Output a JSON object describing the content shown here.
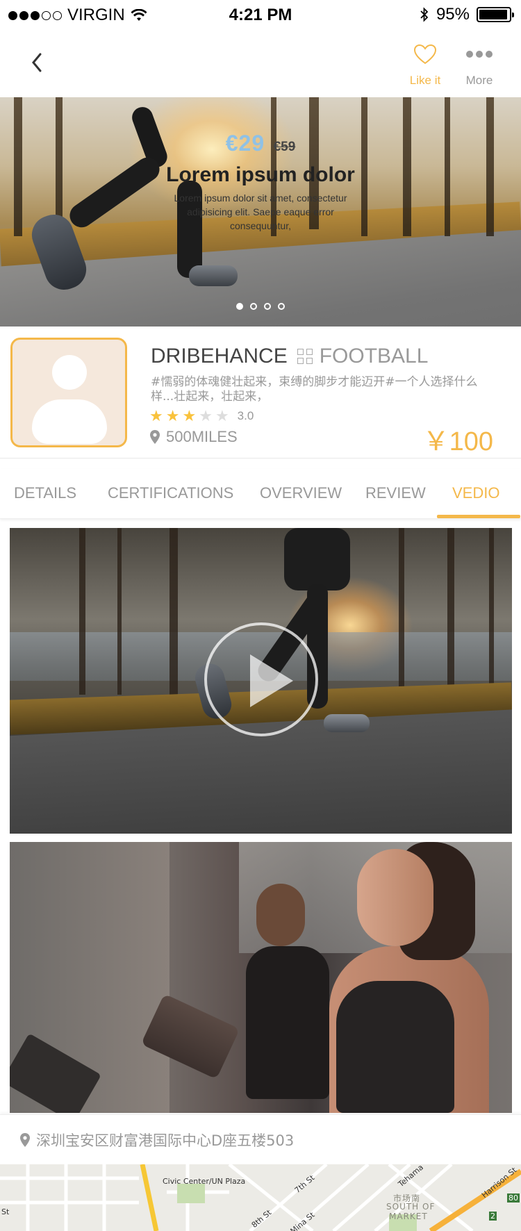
{
  "status_bar": {
    "carrier": "VIRGIN",
    "time": "4:21 PM",
    "battery": "95%",
    "signal_strength": 3
  },
  "nav": {
    "like_label": "Like it",
    "more_label": "More"
  },
  "hero": {
    "price_now": "€29",
    "price_old": "€59",
    "title": "Lorem ipsum dolor",
    "description": "Lorem ipsum dolor sit amet, consectetur adipisicing elit. Saepe eaque error consequuntur,",
    "slide_count": 4,
    "active_slide": 1
  },
  "profile": {
    "name": "DRIBEHANCE",
    "category": "FOOTBALL",
    "description": "#懦弱的体魂健壮起来，束缚的脚步才能迈开#一个人选择什么样...壮起来，壮起来，",
    "rating": 3,
    "rating_max": 5,
    "rating_text": "3.0",
    "distance": "500MILES",
    "price": "￥100"
  },
  "tabs": [
    {
      "label": "DETAILS",
      "active": false
    },
    {
      "label": "CERTIFICATIONS",
      "active": false
    },
    {
      "label": "OVERVIEW",
      "active": false
    },
    {
      "label": "REVIEW",
      "active": false
    },
    {
      "label": "VEDIO",
      "active": true
    }
  ],
  "address": {
    "text": "深圳宝安区财富港国际中心D座五楼503"
  },
  "map": {
    "labels": [
      "Civic Center/UN Plaza",
      "7th St",
      "8th St",
      "Mina St",
      "Tehama",
      "市场南",
      "SOUTH OF",
      "MARKET",
      "Harrison St",
      "80",
      "St",
      "2"
    ]
  },
  "colors": {
    "accent": "#f4b84a",
    "muted": "#999999",
    "price_blue": "#8fc1e6",
    "star": "#f9c23c"
  }
}
